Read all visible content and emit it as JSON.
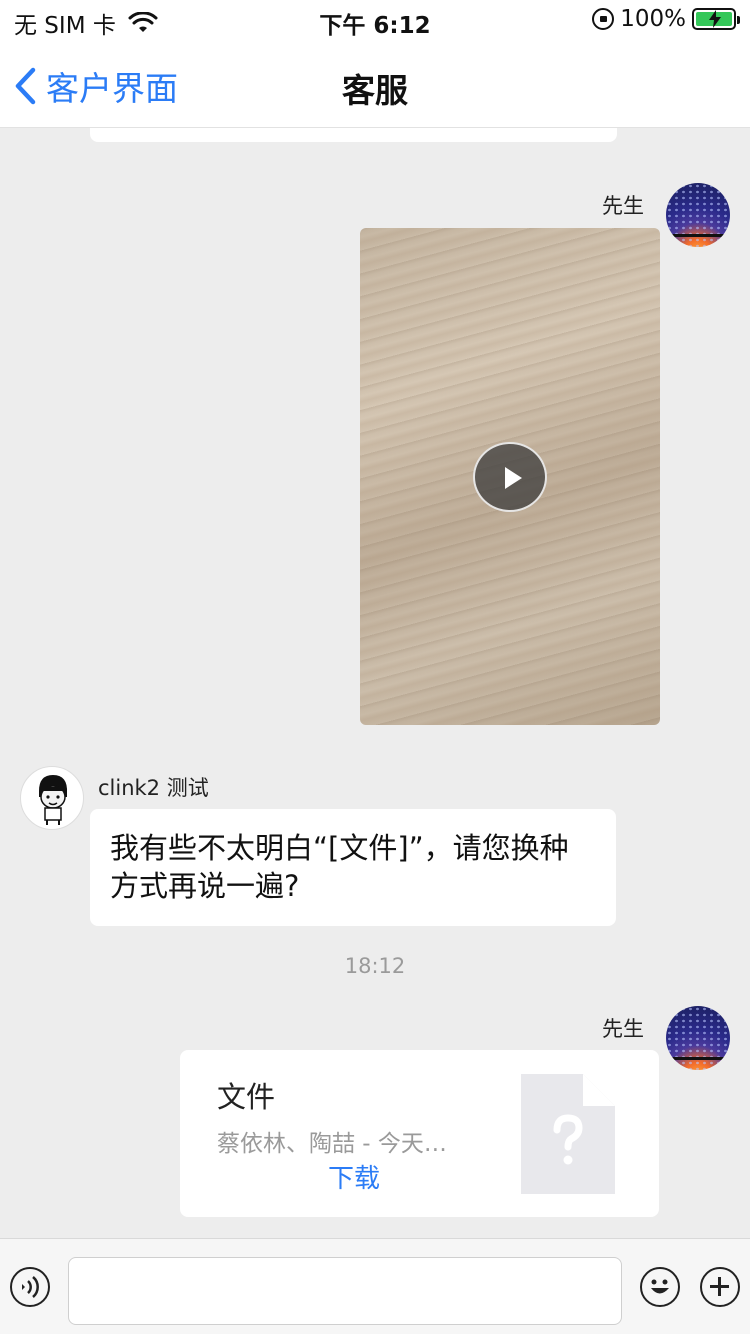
{
  "status_bar": {
    "carrier": "无 SIM 卡",
    "time": "下午 6:12",
    "battery": "100%"
  },
  "nav": {
    "back_label": "客户界面",
    "title": "客服"
  },
  "messages": {
    "video_sender": "先生",
    "agent_name": "clink2 测试",
    "agent_text": "我有些不太明白“[文件]”，请您换种方式再说一遍?",
    "timestamp": "18:12",
    "file_sender": "先生",
    "file": {
      "title": "文件",
      "subtitle": "蔡依林、陶喆 - 今天…",
      "download_label": "下载"
    }
  },
  "input": {
    "placeholder": ""
  },
  "colors": {
    "accent": "#2b7cf6",
    "background": "#ededed",
    "bubble": "#ffffff",
    "battery": "#34c759"
  }
}
